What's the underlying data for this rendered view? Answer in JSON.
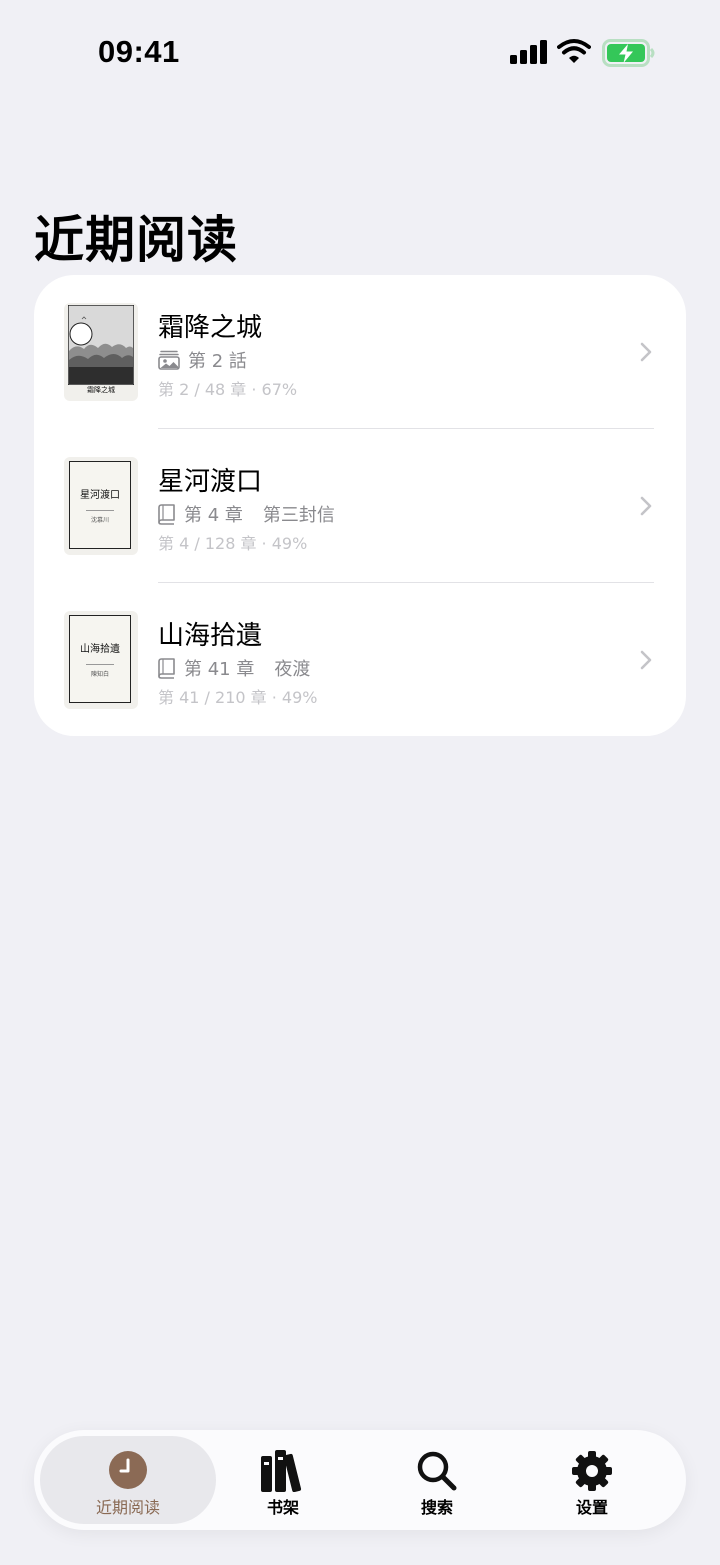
{
  "status_bar": {
    "time": "09:41"
  },
  "page_title": "近期阅读",
  "colors": {
    "accent": "#8B6A55",
    "battery": "#34C759",
    "background": "#F0F0F5"
  },
  "recent_books": [
    {
      "title": "霜降之城",
      "type_icon": "image-stack-icon",
      "chapter_label": "第 2 話",
      "chapter_name": "",
      "progress_text": "第 2 / 48 章 · 67%",
      "progress_percent": 67,
      "cover": {
        "style": "comic",
        "title": "霜降之城",
        "author": ""
      }
    },
    {
      "title": "星河渡口",
      "type_icon": "book-icon",
      "chapter_label": "第 4 章",
      "chapter_name": "第三封信",
      "progress_text": "第 4 / 128 章 · 49%",
      "progress_percent": 49,
      "cover": {
        "style": "text",
        "title": "星河渡口",
        "author": "沈慕川"
      }
    },
    {
      "title": "山海拾遺",
      "type_icon": "book-icon",
      "chapter_label": "第 41 章",
      "chapter_name": "夜渡",
      "progress_text": "第 41 / 210 章 · 49%",
      "progress_percent": 49,
      "cover": {
        "style": "text",
        "title": "山海拾遺",
        "author": "陳知白"
      }
    }
  ],
  "tab_bar": {
    "tabs": [
      {
        "label": "近期阅读",
        "icon": "clock-icon",
        "active": true
      },
      {
        "label": "书架",
        "icon": "books-icon",
        "active": false
      },
      {
        "label": "搜索",
        "icon": "search-icon",
        "active": false
      },
      {
        "label": "设置",
        "icon": "gear-icon",
        "active": false
      }
    ]
  }
}
